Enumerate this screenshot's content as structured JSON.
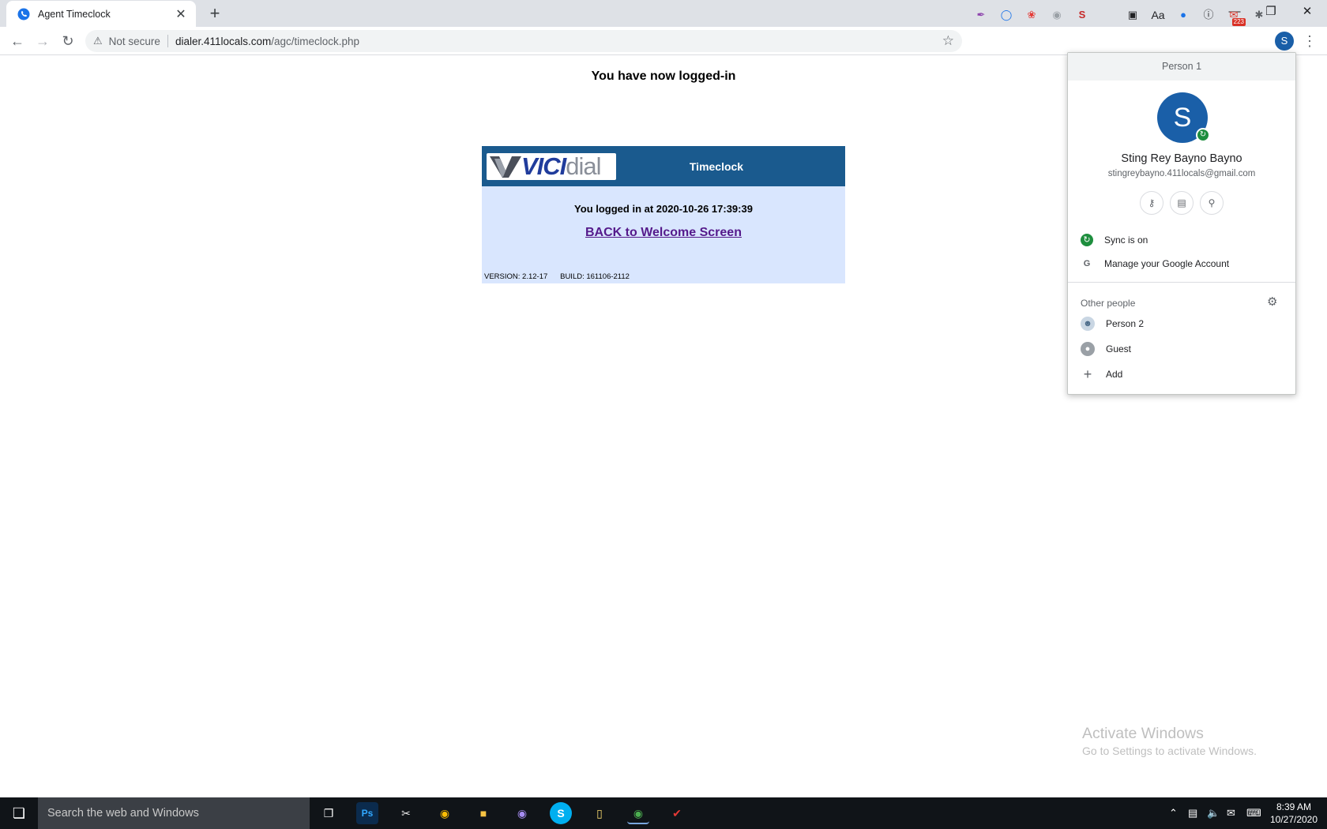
{
  "browser": {
    "tab_title": "Agent Timeclock",
    "new_tab_glyph": "+",
    "close_tab_glyph": "✕",
    "not_secure": "Not secure",
    "url_host": "dialer.411locals.com",
    "url_path": "/agc/timeclock.php",
    "profile_initial": "S",
    "extension_badge": "223"
  },
  "page": {
    "heading": "You have now logged-in",
    "timeclock": {
      "logo_vici": "VICI",
      "logo_dial": "dial",
      "title": "Timeclock",
      "login_message": "You logged in at 2020-10-26 17:39:39",
      "back_link": "BACK to Welcome Screen",
      "version": "VERSION: 2.12-17",
      "build": "BUILD: 161106-2112"
    }
  },
  "profile_menu": {
    "header": "Person 1",
    "avatar_initial": "S",
    "name": "Sting Rey Bayno Bayno",
    "email": "stingreybayno.411locals@gmail.com",
    "sync_status": "Sync is on",
    "manage_account": "Manage your Google Account",
    "other_people_label": "Other people",
    "people": [
      "Person 2",
      "Guest"
    ],
    "add_label": "Add"
  },
  "watermark": {
    "line1": "Activate Windows",
    "line2": "Go to Settings to activate Windows."
  },
  "taskbar": {
    "search_placeholder": "Search the web and Windows",
    "time": "8:39 AM",
    "date": "10/27/2020"
  },
  "colors": {
    "timeclock_header": "#1a5a8e",
    "timeclock_body": "#d9e6fe",
    "avatar": "#1a5fa8",
    "sync_green": "#1e8e3e"
  }
}
